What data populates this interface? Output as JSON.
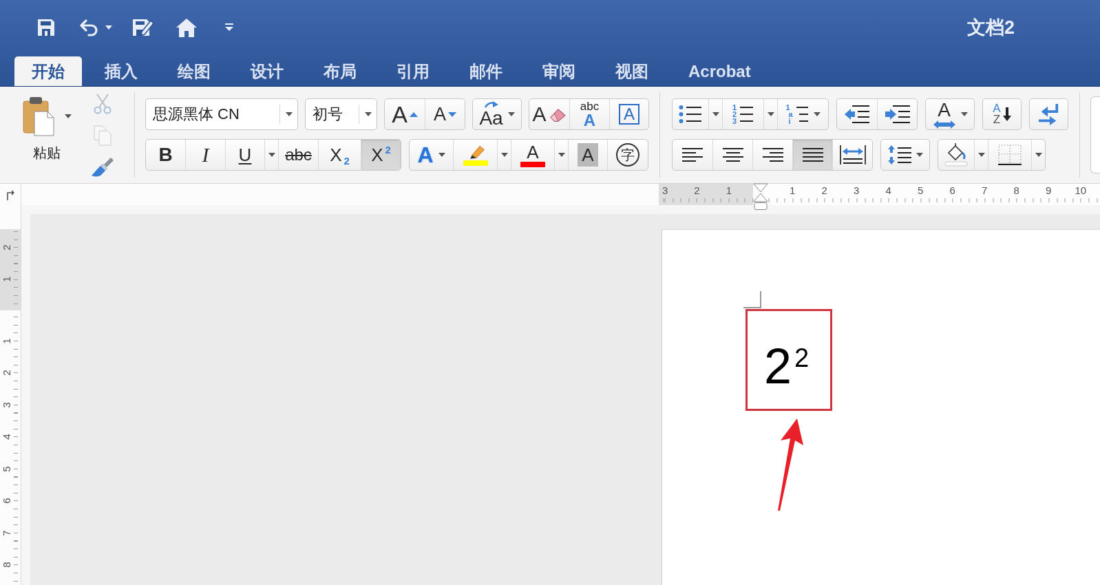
{
  "window": {
    "title": "文档2"
  },
  "tabs": [
    {
      "label": "开始",
      "selected": true
    },
    {
      "label": "插入",
      "selected": false
    },
    {
      "label": "绘图",
      "selected": false
    },
    {
      "label": "设计",
      "selected": false
    },
    {
      "label": "布局",
      "selected": false
    },
    {
      "label": "引用",
      "selected": false
    },
    {
      "label": "邮件",
      "selected": false
    },
    {
      "label": "审阅",
      "selected": false
    },
    {
      "label": "视图",
      "selected": false
    },
    {
      "label": "Acrobat",
      "selected": false
    }
  ],
  "clipboard": {
    "paste_label": "粘贴"
  },
  "clipboard_tools": [
    {
      "kind": "cut",
      "disabled": true
    },
    {
      "kind": "copy",
      "disabled": true
    },
    {
      "kind": "format_painter",
      "disabled": false
    }
  ],
  "font": {
    "name": "思源黑体 CN",
    "size": "初号"
  },
  "font_groups": {
    "row_1": [
      [
        {
          "kind": "grow",
          "glyph": "A"
        },
        {
          "kind": "shrink",
          "glyph": "A"
        }
      ],
      [
        {
          "kind": "change_case",
          "glyph": "Aa"
        }
      ],
      [
        {
          "kind": "clear_formatting",
          "glyph": "A"
        },
        {
          "kind": "phonetic_guide",
          "glyphs": [
            "abc",
            "A"
          ]
        },
        {
          "kind": "character_border",
          "glyph": "A"
        }
      ]
    ],
    "row_2": [
      [
        {
          "kind": "bold",
          "glyph": "B",
          "selected": false
        },
        {
          "kind": "italic",
          "glyph": "I",
          "selected": false
        },
        {
          "kind": "underline",
          "glyph": "U",
          "selected": false
        },
        {
          "kind": "menu",
          "selected": false
        },
        {
          "kind": "strikethrough",
          "glyph": "abc",
          "selected": false
        },
        {
          "kind": "subscript",
          "glyph": "X$_{2}$",
          "selected": false
        },
        {
          "kind": "superscript",
          "glyph": "X$^{2}$",
          "selected": true
        }
      ],
      [
        {
          "kind": "text_effects",
          "glyph": "A"
        },
        {
          "kind": "highlight",
          "color": "#ffff00"
        },
        {
          "kind": "menu"
        },
        {
          "kind": "font_color",
          "glyph": "A",
          "color": "#ff0000"
        },
        {
          "kind": "menu"
        },
        {
          "kind": "character_shading",
          "glyph": "A"
        },
        {
          "kind": "enclosed_character",
          "glyph": "字"
        }
      ]
    ]
  },
  "paragraph_groups": {
    "row_1": [
      [
        {
          "kind": "bullets"
        },
        {
          "kind": "menu"
        },
        {
          "kind": "numbering",
          "glyphs": [
            "1",
            "2",
            "3"
          ]
        },
        {
          "kind": "menu"
        },
        {
          "kind": "multilevel",
          "glyphs": [
            "1",
            "a",
            "i"
          ]
        }
      ],
      [
        {
          "kind": "decrease_indent"
        },
        {
          "kind": "increase_indent"
        }
      ],
      [
        {
          "kind": "text_direction",
          "glyph": "A"
        }
      ],
      [
        {
          "kind": "sort",
          "glyphs": [
            "A",
            "Z"
          ]
        }
      ],
      [
        {
          "kind": "return_arrows"
        }
      ]
    ],
    "row_2": [
      [
        {
          "kind": "align_left",
          "selected": false
        },
        {
          "kind": "align_center",
          "selected": false
        },
        {
          "kind": "align_right",
          "selected": false
        },
        {
          "kind": "justify",
          "selected": true
        },
        {
          "kind": "distributed",
          "selected": false
        }
      ],
      [
        {
          "kind": "line_spacing"
        }
      ],
      [
        {
          "kind": "shading"
        },
        {
          "kind": "menu"
        },
        {
          "kind": "borders"
        },
        {
          "kind": "menu"
        }
      ]
    ]
  },
  "ruler": {
    "left_numbers": [
      "3",
      "2",
      "1"
    ],
    "right_numbers": [
      "1",
      "2",
      "3",
      "4",
      "5",
      "6",
      "7",
      "8",
      "9",
      "10"
    ]
  },
  "vertical_ruler": {
    "top_numbers": [
      "2",
      "1"
    ],
    "numbers": [
      "1",
      "2",
      "3",
      "4",
      "5",
      "6",
      "7",
      "8"
    ]
  },
  "document": {
    "text": "2$^{2}$"
  }
}
